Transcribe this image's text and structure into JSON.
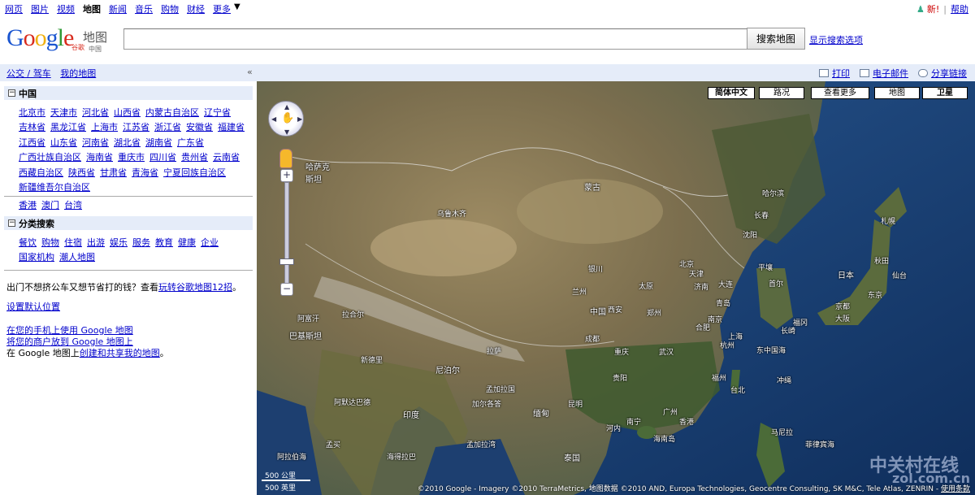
{
  "topnav": {
    "items": [
      "网页",
      "图片",
      "视频",
      "地图",
      "新闻",
      "音乐",
      "购物",
      "财经",
      "更多"
    ],
    "active": "地图",
    "more_arrow": "▼",
    "new_label": "新!",
    "help_label": "帮助",
    "separator": "|"
  },
  "header": {
    "logo_letters": [
      "G",
      "o",
      "o",
      "g",
      "l",
      "e"
    ],
    "logo_cn": "谷歌",
    "logo_map": "地图",
    "logo_region": "中国",
    "search_value": "",
    "search_button": "搜索地图",
    "search_options": "显示搜索选项"
  },
  "subbar": {
    "transit": "公交 / 驾车",
    "my_maps": "我的地图",
    "collapse": "«",
    "print": "打印",
    "email": "电子邮件",
    "share": "分享链接"
  },
  "panel": {
    "china_header": "中国",
    "box_minus": "−",
    "provinces": [
      [
        "北京市",
        "天津市",
        "河北省",
        "山西省",
        "内蒙古自治区",
        "辽宁省"
      ],
      [
        "吉林省",
        "黑龙江省",
        "上海市",
        "江苏省",
        "浙江省",
        "安徽省",
        "福建省"
      ],
      [
        "江西省",
        "山东省",
        "河南省",
        "湖北省",
        "湖南省",
        "广东省"
      ],
      [
        "广西壮族自治区",
        "海南省",
        "重庆市",
        "四川省",
        "贵州省",
        "云南省"
      ],
      [
        "西藏自治区",
        "陕西省",
        "甘肃省",
        "青海省",
        "宁夏回族自治区"
      ],
      [
        "新疆维吾尔自治区"
      ]
    ],
    "regions": [
      "香港",
      "澳门",
      "台湾"
    ],
    "category_header": "分类搜索",
    "categories": [
      [
        "餐饮",
        "购物",
        "住宿",
        "出游",
        "娱乐",
        "服务",
        "教育",
        "健康",
        "企业"
      ],
      [
        "国家机构",
        "潮人地图"
      ]
    ],
    "tip_text": "出门不想挤公车又想节省打的钱？查看",
    "tip_link": "玩转谷歌地图12招",
    "tip_end": "。",
    "default_location": "设置默认位置",
    "mobile_link": "在您的手机上使用 Google 地图",
    "business_link": "将您的商户放到 Google 地图上",
    "create_prefix": "在 Google 地图上",
    "create_link": "创建和共享我的地图",
    "create_end": "。"
  },
  "map": {
    "types": [
      "简体中文",
      "路况",
      "查看更多",
      "地图",
      "卫星"
    ],
    "active_type": "简体中文",
    "labels": {
      "kazakhstan": "哈萨克\n斯坦",
      "mongolia": "蒙古",
      "urumqi": "乌鲁木齐",
      "china": "中国",
      "beijing": "北京",
      "shenyang": "沈阳",
      "harbin": "哈尔滨",
      "changchun": "长春",
      "sapporo": "札幌",
      "japan": "日本",
      "tokyo": "东京",
      "osaka": "大阪",
      "seoul": "首尔",
      "pyongyang": "平壤",
      "shanghai": "上海",
      "wuhan": "武汉",
      "chongqing": "重庆",
      "chengdu": "成都",
      "xian": "西安",
      "lanzhou": "兰州",
      "yinchuan": "银川",
      "taiyuan": "太原",
      "jinan": "济南",
      "zhengzhou": "郑州",
      "hefei": "合肥",
      "nanjing": "南京",
      "hangzhou": "杭州",
      "fuzhou": "福州",
      "taipei": "台北",
      "hongkong": "香港",
      "guangzhou": "广州",
      "nanning": "南宁",
      "kunming": "昆明",
      "guiyang": "贵阳",
      "lhasa": "拉萨",
      "nepal": "尼泊尔",
      "newdelhi": "新德里",
      "india": "印度",
      "pakistan": "巴基斯坦",
      "afghanistan": "阿富汗",
      "lahore": "拉合尔",
      "kolkata": "加尔各答",
      "bangladesh": "孟加拉国",
      "myanmar": "缅甸",
      "hanoi": "河内",
      "thailand": "泰国",
      "manila": "马尼拉",
      "eastchinasea": "东中国海",
      "okinawa": "冲绳",
      "philippinesea": "菲律宾海",
      "hainan": "海南岛",
      "mumbai": "孟买",
      "ahmedabad": "阿默达巴德",
      "hyderabad": "海得拉巴",
      "bayofbengal": "孟加拉湾",
      "arabiansea": "阿拉伯海",
      "tianjin": "天津",
      "dalian": "大连",
      "qingdao": "青岛",
      "fukuoka": "福冈",
      "nagasaki": "长崎",
      "kyoto": "京都",
      "sendai": "仙台",
      "akita": "秋田"
    },
    "scale_km": "500 公里",
    "scale_mi": "500 英里",
    "attribution": "©2010 Google - Imagery ©2010 TerraMetrics, 地图数据 ©2010 AND, Europa Technologies, Geocentre Consulting, SK M&C, Tele Atlas, ZENRIN -",
    "terms": "使用条款",
    "watermark": "中关村在线",
    "watermark_sub": "zol.com.cn"
  }
}
